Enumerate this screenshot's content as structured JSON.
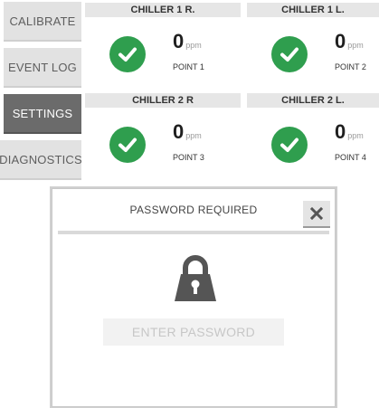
{
  "nav": {
    "items": [
      {
        "label": "CALIBRATE",
        "active": false
      },
      {
        "label": "EVENT LOG",
        "active": false
      },
      {
        "label": "SETTINGS",
        "active": true
      },
      {
        "label": "DIAGNOSTICS",
        "active": false
      }
    ]
  },
  "sensors": [
    {
      "title": "CHILLER 1 R.",
      "value": "0",
      "unit": "ppm",
      "point": "POINT 1",
      "status_icon": "check-circle-icon"
    },
    {
      "title": "CHILLER 1 L.",
      "value": "0",
      "unit": "ppm",
      "point": "POINT 2",
      "status_icon": "check-circle-icon"
    },
    {
      "title": "CHILLER 2 R",
      "value": "0",
      "unit": "ppm",
      "point": "POINT 3",
      "status_icon": "check-circle-icon"
    },
    {
      "title": "CHILLER 2 L.",
      "value": "0",
      "unit": "ppm",
      "point": "POINT 4",
      "status_icon": "check-circle-icon"
    }
  ],
  "modal": {
    "title": "PASSWORD REQUIRED",
    "close_icon": "close-icon",
    "lock_icon": "lock-icon",
    "password_placeholder": "ENTER PASSWORD",
    "password_value": ""
  },
  "colors": {
    "ok_green": "#2f9e4e",
    "nav_active": "#6b6b6b",
    "nav_inactive": "#e2e2e2",
    "header_gray": "#e6e6e6"
  }
}
